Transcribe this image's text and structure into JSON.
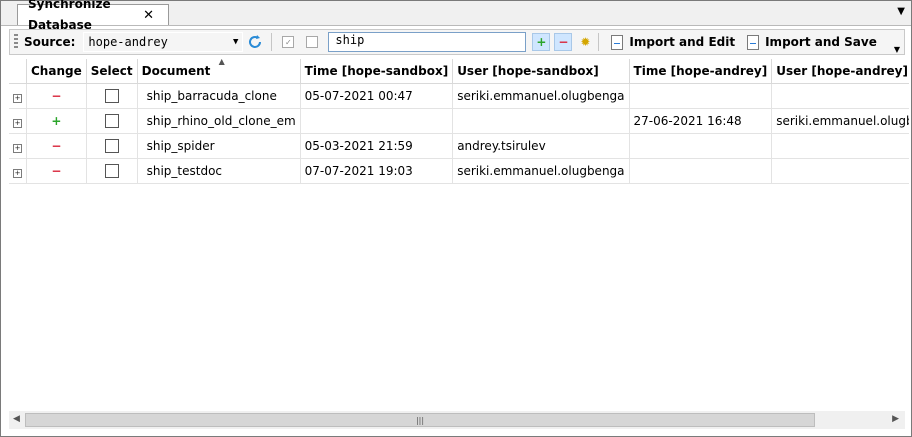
{
  "tab": {
    "title": "Synchronize Database",
    "close": "✕"
  },
  "tab_menu": "▼",
  "toolbar": {
    "source_label": "Source:",
    "source_value": "hope-andrey",
    "filter_value": "ship",
    "import_edit_label": "Import and Edit",
    "import_save_label": "Import and Save"
  },
  "columns": [
    "Change",
    "Select",
    "Document",
    "Time [hope-sandbox]",
    "User [hope-sandbox]",
    "Time [hope-andrey]",
    "User [hope-andrey]"
  ],
  "rows": [
    {
      "change": "−",
      "change_type": "remove",
      "document": "ship_barracuda_clone",
      "time_sandbox": "05-07-2021 00:47",
      "user_sandbox": "seriki.emmanuel.olugbenga",
      "time_andrey": "",
      "user_andrey": ""
    },
    {
      "change": "+",
      "change_type": "add",
      "document": "ship_rhino_old_clone_em",
      "time_sandbox": "",
      "user_sandbox": "",
      "time_andrey": "27-06-2021 16:48",
      "user_andrey": "seriki.emmanuel.olugbenga"
    },
    {
      "change": "−",
      "change_type": "remove",
      "document": "ship_spider",
      "time_sandbox": "05-03-2021 21:59",
      "user_sandbox": "andrey.tsirulev",
      "time_andrey": "",
      "user_andrey": ""
    },
    {
      "change": "−",
      "change_type": "remove",
      "document": "ship_testdoc",
      "time_sandbox": "07-07-2021 19:03",
      "user_sandbox": "seriki.emmanuel.olugbenga",
      "time_andrey": "",
      "user_andrey": ""
    }
  ],
  "colors": {
    "add": "#2ba52b",
    "remove": "#d9253a",
    "refresh": "#2a8bd6",
    "gear": "#d4a600"
  }
}
